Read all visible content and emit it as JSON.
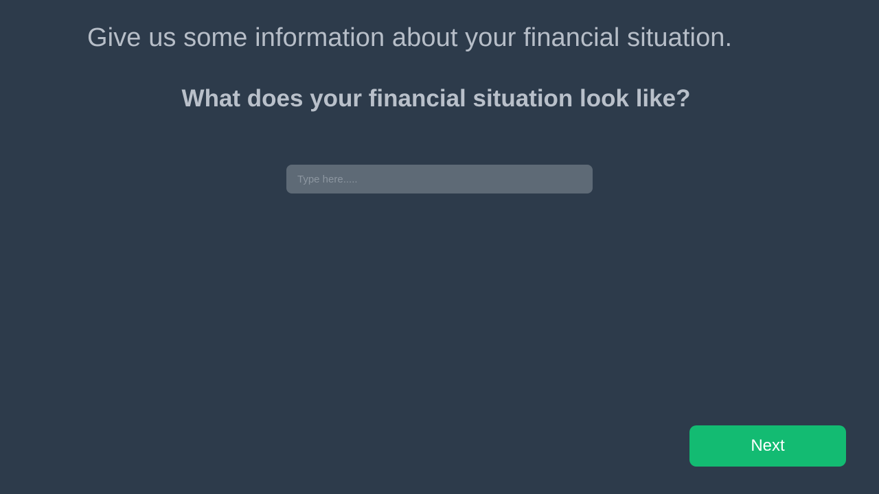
{
  "header": {
    "intro_text": "Give us some information about your financial situation."
  },
  "question": {
    "text": "What does your financial situation look like?"
  },
  "answer": {
    "value": "",
    "placeholder": "Type here....."
  },
  "footer": {
    "next_label": "Next"
  },
  "colors": {
    "background": "#2d3b4b",
    "input_background": "#5e6a76",
    "accent": "#13bb72"
  }
}
